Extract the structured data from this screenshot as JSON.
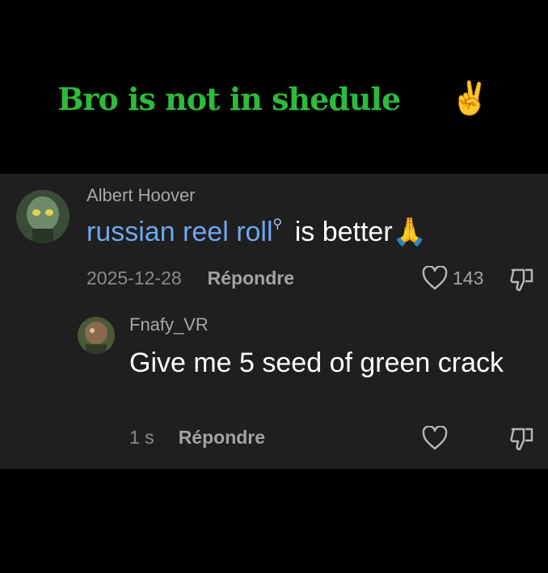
{
  "caption": {
    "text": "Bro is not in shedule",
    "emoji_1": "😌",
    "emoji_2": "✌️"
  },
  "comments": [
    {
      "author": "Albert Hoover",
      "link_text": "russian reel roll",
      "text_after": " is better",
      "emoji": "🙏",
      "date": "2025-12-28",
      "reply_label": "Répondre",
      "likes": "143",
      "avatar_icon": "alien-avatar"
    },
    {
      "author": "Fnafy_VR",
      "text": "Give me 5 seed of green crack",
      "date": "1 s",
      "reply_label": "Répondre",
      "avatar_icon": "character-avatar"
    }
  ],
  "colors": {
    "caption": "#2dbb3a",
    "link": "#6fa6ee",
    "panel": "#1f1f1f"
  }
}
